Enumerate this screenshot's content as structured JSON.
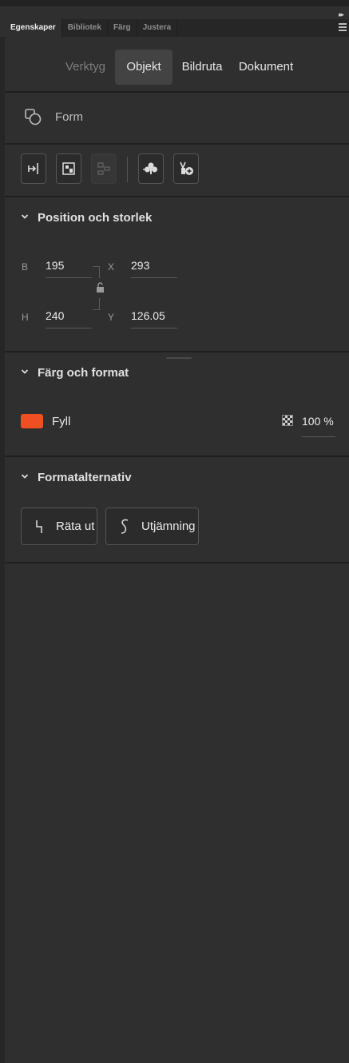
{
  "panel": {
    "tabs": [
      "Egenskaper",
      "Bibliotek",
      "Färg",
      "Justera"
    ],
    "active_tab": "Egenskaper",
    "collapse_icon": "double-chevron-right-icon",
    "menu_icon": "hamburger-menu-icon"
  },
  "subtabs": {
    "tools": "Verktyg",
    "object": "Objekt",
    "frame": "Bildruta",
    "document": "Dokument"
  },
  "object_type": {
    "label": "Form",
    "icon": "shape-icon"
  },
  "toolbar": {
    "icons": [
      "align-to-stage-icon",
      "convert-to-symbol-icon",
      "break-apart-icon",
      "add-to-asset-warp-icon",
      "add-to-library-icon"
    ]
  },
  "position_size": {
    "title": "Position och storlek",
    "width_label": "B",
    "width_value": "195",
    "height_label": "H",
    "height_value": "240",
    "x_label": "X",
    "x_value": "293",
    "y_label": "Y",
    "y_value": "126.05",
    "lock_icon": "unlock-icon"
  },
  "color_format": {
    "title": "Färg och format",
    "fill_label": "Fyll",
    "fill_color": "#f04e23",
    "opacity_icon": "checkerboard-icon",
    "opacity_value": "100 %"
  },
  "format_options": {
    "title": "Formatalternativ",
    "straighten_label": "Räta ut",
    "smooth_label": "Utjämning"
  },
  "colors": {
    "panel_bg": "#2f2f2f",
    "tab_strip_bg": "#262626",
    "active_subtab_bg": "#434343",
    "divider": "#1f1f1f"
  }
}
